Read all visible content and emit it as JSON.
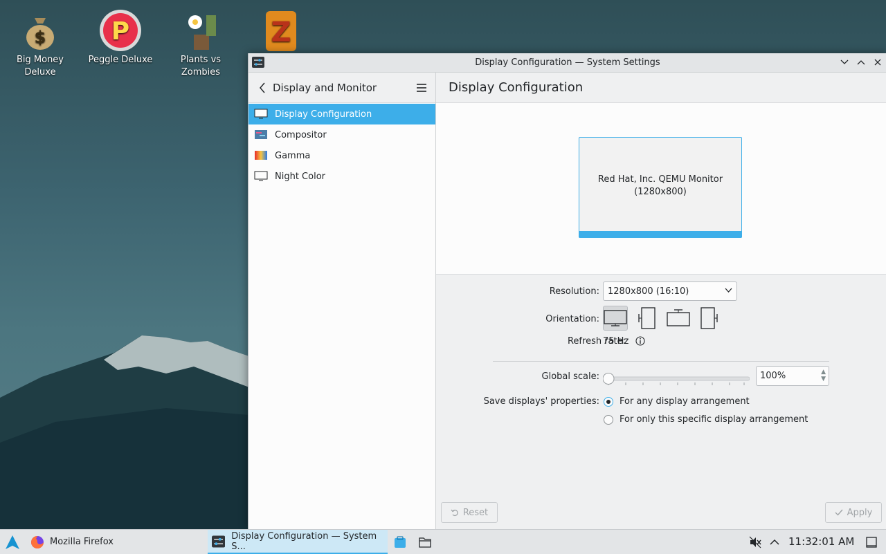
{
  "desktop": {
    "icons": [
      {
        "label_line1": "Big Money",
        "label_line2": "Deluxe"
      },
      {
        "label_line1": "Peggle Deluxe",
        "label_line2": ""
      },
      {
        "label_line1": "Plants vs",
        "label_line2": "Zombies"
      },
      {
        "label_line1": "",
        "label_line2": ""
      }
    ]
  },
  "window": {
    "title": "Display Configuration — System Settings"
  },
  "sidebar": {
    "header": "Display and Monitor",
    "items": [
      {
        "label": "Display Configuration"
      },
      {
        "label": "Compositor"
      },
      {
        "label": "Gamma"
      },
      {
        "label": "Night Color"
      }
    ]
  },
  "content": {
    "title": "Display Configuration",
    "monitor_name": "Red Hat, Inc. QEMU Monitor",
    "monitor_resolution": "(1280x800)",
    "resolution_label": "Resolution:",
    "resolution_value": "1280x800 (16:10)",
    "orientation_label": "Orientation:",
    "refresh_label": "Refresh rate:",
    "refresh_value": "75 Hz",
    "scale_label": "Global scale:",
    "scale_value": "100%",
    "save_label": "Save displays' properties:",
    "save_option_any": "For any display arrangement",
    "save_option_specific": "For only this specific display arrangement",
    "reset_label": "Reset",
    "apply_label": "Apply"
  },
  "taskbar": {
    "tasks": [
      {
        "label": "Mozilla Firefox"
      },
      {
        "label": "Display Configuration  — System S..."
      }
    ],
    "clock": "11:32:01 AM"
  },
  "colors": {
    "accent": "#3daee9",
    "window_bg": "#eff0f1",
    "view_bg": "#fcfcfc"
  }
}
